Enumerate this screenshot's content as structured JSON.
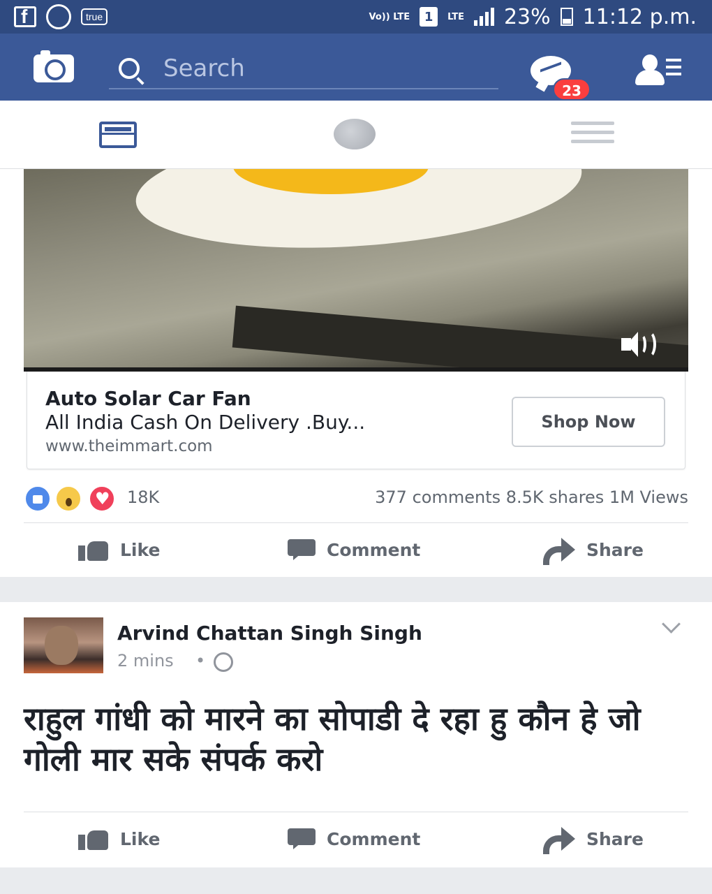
{
  "status_bar": {
    "notification_icons": [
      "facebook-icon",
      "whatsapp-icon",
      "true-app-icon"
    ],
    "true_label": "true",
    "volte_label": "Vo)) LTE",
    "sim_label": "1",
    "lte_label": "LTE",
    "battery": "23%",
    "time": "11:12 p.m."
  },
  "header": {
    "search_placeholder": "Search",
    "messages_badge": "23",
    "icons": [
      "camera-icon",
      "search-icon",
      "messenger-icon",
      "friend-requests-icon"
    ]
  },
  "tabs": [
    {
      "name": "news-feed",
      "icon": "news-feed-icon",
      "active": true
    },
    {
      "name": "notifications",
      "icon": "globe-icon",
      "active": false
    },
    {
      "name": "menu",
      "icon": "hamburger-menu-icon",
      "active": false
    }
  ],
  "sponsored_post": {
    "ad_title": "Auto Solar Car Fan",
    "ad_description": "All India Cash On Delivery .Buy...",
    "ad_url": "www.theimmart.com",
    "cta_label": "Shop Now",
    "reaction_count": "18K",
    "stats": "377 comments 8.5K shares 1M Views",
    "actions": {
      "like": "Like",
      "comment": "Comment",
      "share": "Share"
    }
  },
  "post": {
    "author": "Arvind Chattan Singh Singh",
    "time": "2 mins",
    "dot": "•",
    "text": "राहुल गांधी को मारने का सोपाडी दे रहा हु कौन हे जो गोली मार सके संपर्क करो",
    "actions": {
      "like": "Like",
      "comment": "Comment",
      "share": "Share"
    }
  },
  "colors": {
    "brand_blue": "#3b5998",
    "status_bar": "#2f4a80",
    "badge_red": "#fa3e3e",
    "feed_bg": "#e9ebee"
  }
}
